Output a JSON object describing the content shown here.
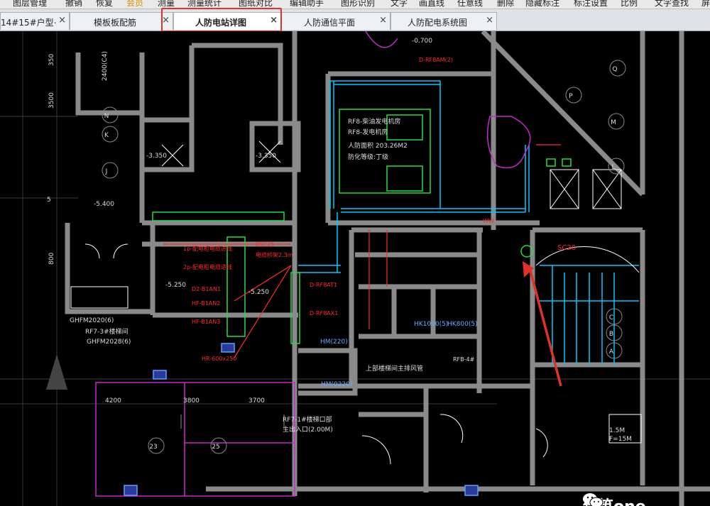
{
  "menu": [
    "图层管理",
    "撤销",
    "恢复",
    "会员",
    "测量",
    "测量统计",
    "图纸对比",
    "编辑助手",
    "图形识别",
    "文字",
    "画直线",
    "任意线",
    "删除",
    "隐藏标注",
    "标注设置",
    "比例",
    "文字查找",
    "屏"
  ],
  "tabs": [
    {
      "label": "14#15#户型⋯",
      "close": "×"
    },
    {
      "label": "模板板配筋",
      "close": "×"
    },
    {
      "label": "人防电站详图",
      "close": "×"
    },
    {
      "label": "人防通信平面",
      "close": "×"
    },
    {
      "label": "人防配电系统图",
      "close": "×"
    }
  ],
  "active_tab": "人防电站详图",
  "drawing": {
    "grid_left": [
      "N",
      "K",
      "J"
    ],
    "grid_right": [
      "Q",
      "P",
      "M",
      "L"
    ],
    "grid_bottom": [
      "23",
      "25"
    ],
    "grid_stair": [
      "C",
      "B",
      "A"
    ],
    "dims_left": [
      "350",
      "2400(C4)",
      "3500",
      "5",
      "800"
    ],
    "dims_bottom": [
      "4200",
      "3800",
      "3700"
    ],
    "red_labels": [
      "D-RF8AM(2)",
      "1p-配电柜电缆进线",
      "2p-配电柜电缆进线",
      "D2-B1AN1",
      "HF-B1AN2",
      "HF-B1AN3",
      "HR-600x250",
      "BSC25",
      "电缆桥架2.3m",
      "D-RF8AT1",
      "D-RF8AX1",
      "RFB-4#",
      "WW",
      "SC20"
    ],
    "white_labels": [
      "RF8-柴油发电机房",
      "RF8-发电机房",
      "人防面积 203.26M2",
      "防化等级:丁级",
      "GHFM2020(6)",
      "RF7-3#楼梯间",
      "GHFM2028(6)",
      "RF7-1#楼梯口部",
      "主出入口(2.00M)",
      "上部楼梯间主排风管",
      "HK1000(5)",
      "HK800(5)",
      "HM(220)",
      "HM(0220)",
      "1.5M",
      "F=15M"
    ],
    "levels": [
      "-5.400",
      "-5.250",
      "-5.250",
      "-3.350",
      "-3.350",
      "-0.700"
    ],
    "watermark": "建筑one"
  },
  "colors": {
    "background": "#000000",
    "wall": "#8a8a8a",
    "red": "#ff2a2a",
    "cyan": "#00c8ff",
    "green": "#22dd44",
    "magenta": "#c22cc8",
    "highlight": "#e0312a"
  }
}
